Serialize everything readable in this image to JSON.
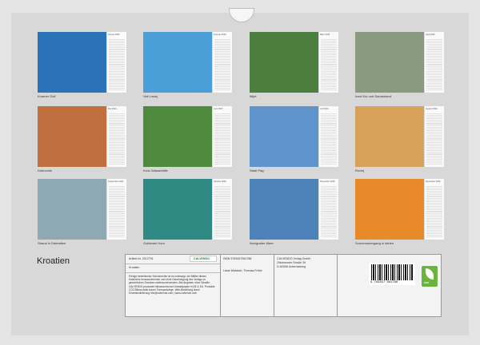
{
  "calendar_title": "Kroatien",
  "months": [
    {
      "month": "Januar 2026",
      "caption": "Kvarner Golf"
    },
    {
      "month": "Februar 2026",
      "caption": "Veli Losinj"
    },
    {
      "month": "März 2026",
      "caption": "Mljet"
    },
    {
      "month": "April 2026",
      "caption": "Insel Krk und Sandstrand"
    },
    {
      "month": "Mai 2026",
      "caption": "Dubrovnik"
    },
    {
      "month": "Juni 2026",
      "caption": "Krcic Wasserfälle"
    },
    {
      "month": "Juli 2026",
      "caption": "Stadt Pag"
    },
    {
      "month": "August 2026",
      "caption": "Rovinj"
    },
    {
      "month": "September 2026",
      "caption": "Strand in Dalmatien"
    },
    {
      "month": "Oktober 2026",
      "caption": "Goldenes Horn"
    },
    {
      "month": "November 2026",
      "caption": "Novigrader Meer"
    },
    {
      "month": "Dezember 2026",
      "caption": "Sonnenuntergang in Istrien"
    }
  ],
  "imprint": {
    "article_no": "Artikel-Nr. 2012791",
    "publisher_logo": "CALVENDO",
    "isbn": "ISBN 9783457981788",
    "publisher": "CALVENDO Verlag GmbH",
    "street": "Ottobrunner Straße 39",
    "city": "D-82008 Unterhaching",
    "product_title": "Kroatien",
    "authors": "Liane Matrisch, Thomas Fröbe",
    "blurb": "Erfolge bestehender Schutzrechte ist es untersagt, die Blätter dieses Kalenders herauszutrennen und ohne Genehmigung des Verlags zu gewerblichen Zwecken weiterzuverwenden. Alle Angaben ohne Gewähr. CALVENDO produziert klimaneutral auf Umweltpapier in DE & EU. Produkte CO2-Bilanz dank kurzer Transportwege. Web-Bestellung durch Einzelauslieferung Info@calvendo.com | www.calvendo.com",
    "barcode_digits": "9 783457 981788",
    "eco_label": "eco"
  },
  "colors": {
    "sheet": "#d8d8d8",
    "month_page": "#fafafa",
    "eco_badge": "#6db33f",
    "logo_text": "#2a6f3b"
  }
}
